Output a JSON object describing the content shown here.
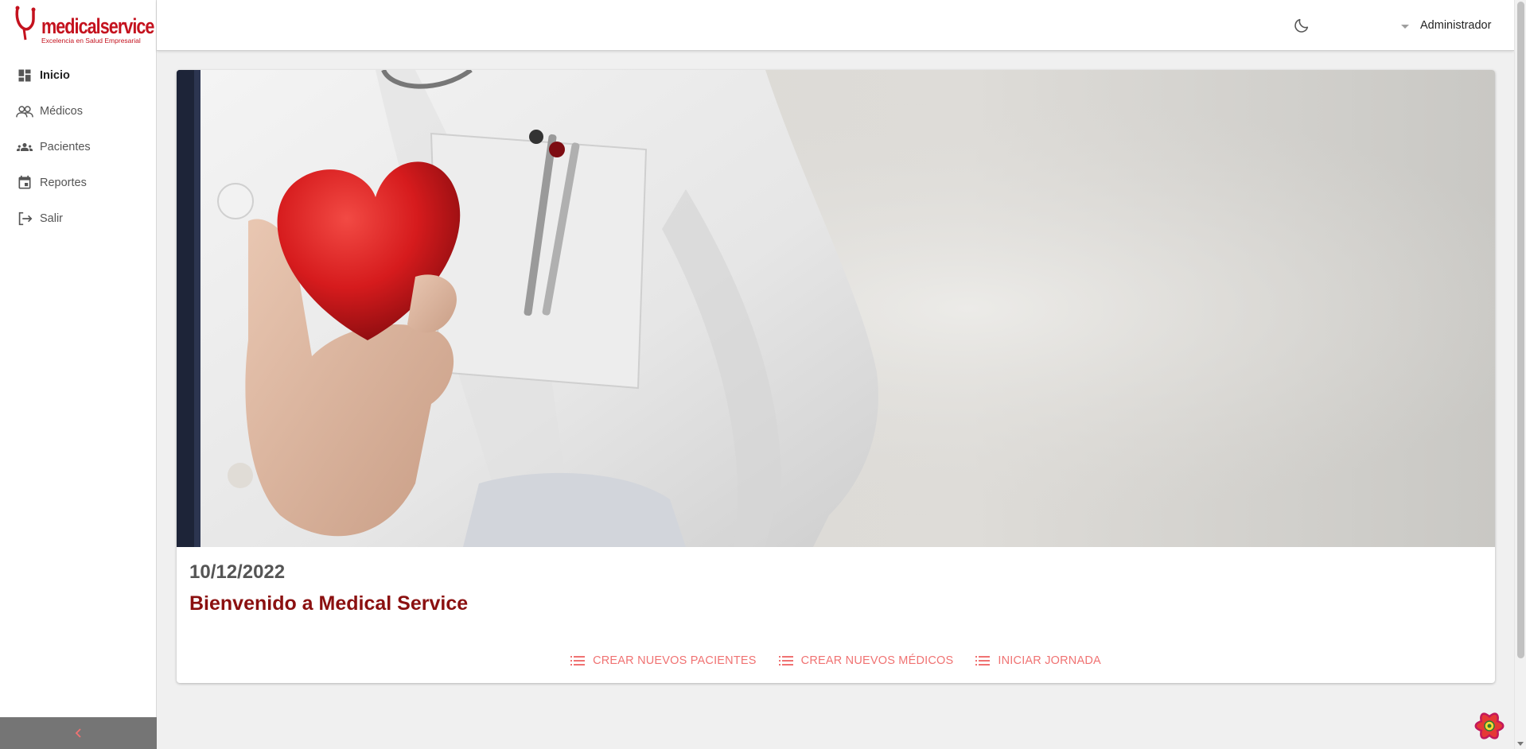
{
  "brand": {
    "name": "medicalservice",
    "tagline": "Excelencia en Salud Empresarial",
    "color": "#c4121e"
  },
  "sidebar": {
    "items": [
      {
        "label": "Inicio",
        "icon": "dashboard-icon",
        "active": true
      },
      {
        "label": "Médicos",
        "icon": "doctors-icon",
        "active": false
      },
      {
        "label": "Pacientes",
        "icon": "patients-icon",
        "active": false
      },
      {
        "label": "Reportes",
        "icon": "calendar-icon",
        "active": false
      },
      {
        "label": "Salir",
        "icon": "logout-icon",
        "active": false
      }
    ],
    "collapse_icon": "chevron-left-icon"
  },
  "header": {
    "theme_icon": "moon-icon",
    "user_name": "Administrador"
  },
  "card": {
    "date": "10/12/2022",
    "title": "Bienvenido a Medical Service",
    "actions": [
      {
        "label": "CREAR NUEVOS PACIENTES",
        "icon": "list-icon"
      },
      {
        "label": "CREAR NUEVOS MÉDICOS",
        "icon": "list-icon"
      },
      {
        "label": "INICIAR JORNADA",
        "icon": "list-icon"
      }
    ]
  },
  "colors": {
    "accent": "#f07272",
    "title": "#8b1010",
    "sidebar_footer": "#757575"
  }
}
